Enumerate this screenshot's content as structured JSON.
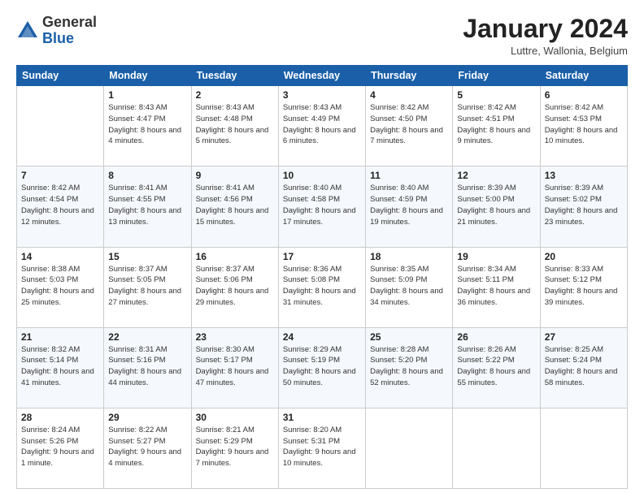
{
  "header": {
    "logo": {
      "general": "General",
      "blue": "Blue"
    },
    "title": "January 2024",
    "subtitle": "Luttre, Wallonia, Belgium"
  },
  "calendar": {
    "days_of_week": [
      "Sunday",
      "Monday",
      "Tuesday",
      "Wednesday",
      "Thursday",
      "Friday",
      "Saturday"
    ],
    "weeks": [
      [
        {
          "day": "",
          "sunrise": "",
          "sunset": "",
          "daylight": ""
        },
        {
          "day": "1",
          "sunrise": "Sunrise: 8:43 AM",
          "sunset": "Sunset: 4:47 PM",
          "daylight": "Daylight: 8 hours and 4 minutes."
        },
        {
          "day": "2",
          "sunrise": "Sunrise: 8:43 AM",
          "sunset": "Sunset: 4:48 PM",
          "daylight": "Daylight: 8 hours and 5 minutes."
        },
        {
          "day": "3",
          "sunrise": "Sunrise: 8:43 AM",
          "sunset": "Sunset: 4:49 PM",
          "daylight": "Daylight: 8 hours and 6 minutes."
        },
        {
          "day": "4",
          "sunrise": "Sunrise: 8:42 AM",
          "sunset": "Sunset: 4:50 PM",
          "daylight": "Daylight: 8 hours and 7 minutes."
        },
        {
          "day": "5",
          "sunrise": "Sunrise: 8:42 AM",
          "sunset": "Sunset: 4:51 PM",
          "daylight": "Daylight: 8 hours and 9 minutes."
        },
        {
          "day": "6",
          "sunrise": "Sunrise: 8:42 AM",
          "sunset": "Sunset: 4:53 PM",
          "daylight": "Daylight: 8 hours and 10 minutes."
        }
      ],
      [
        {
          "day": "7",
          "sunrise": "Sunrise: 8:42 AM",
          "sunset": "Sunset: 4:54 PM",
          "daylight": "Daylight: 8 hours and 12 minutes."
        },
        {
          "day": "8",
          "sunrise": "Sunrise: 8:41 AM",
          "sunset": "Sunset: 4:55 PM",
          "daylight": "Daylight: 8 hours and 13 minutes."
        },
        {
          "day": "9",
          "sunrise": "Sunrise: 8:41 AM",
          "sunset": "Sunset: 4:56 PM",
          "daylight": "Daylight: 8 hours and 15 minutes."
        },
        {
          "day": "10",
          "sunrise": "Sunrise: 8:40 AM",
          "sunset": "Sunset: 4:58 PM",
          "daylight": "Daylight: 8 hours and 17 minutes."
        },
        {
          "day": "11",
          "sunrise": "Sunrise: 8:40 AM",
          "sunset": "Sunset: 4:59 PM",
          "daylight": "Daylight: 8 hours and 19 minutes."
        },
        {
          "day": "12",
          "sunrise": "Sunrise: 8:39 AM",
          "sunset": "Sunset: 5:00 PM",
          "daylight": "Daylight: 8 hours and 21 minutes."
        },
        {
          "day": "13",
          "sunrise": "Sunrise: 8:39 AM",
          "sunset": "Sunset: 5:02 PM",
          "daylight": "Daylight: 8 hours and 23 minutes."
        }
      ],
      [
        {
          "day": "14",
          "sunrise": "Sunrise: 8:38 AM",
          "sunset": "Sunset: 5:03 PM",
          "daylight": "Daylight: 8 hours and 25 minutes."
        },
        {
          "day": "15",
          "sunrise": "Sunrise: 8:37 AM",
          "sunset": "Sunset: 5:05 PM",
          "daylight": "Daylight: 8 hours and 27 minutes."
        },
        {
          "day": "16",
          "sunrise": "Sunrise: 8:37 AM",
          "sunset": "Sunset: 5:06 PM",
          "daylight": "Daylight: 8 hours and 29 minutes."
        },
        {
          "day": "17",
          "sunrise": "Sunrise: 8:36 AM",
          "sunset": "Sunset: 5:08 PM",
          "daylight": "Daylight: 8 hours and 31 minutes."
        },
        {
          "day": "18",
          "sunrise": "Sunrise: 8:35 AM",
          "sunset": "Sunset: 5:09 PM",
          "daylight": "Daylight: 8 hours and 34 minutes."
        },
        {
          "day": "19",
          "sunrise": "Sunrise: 8:34 AM",
          "sunset": "Sunset: 5:11 PM",
          "daylight": "Daylight: 8 hours and 36 minutes."
        },
        {
          "day": "20",
          "sunrise": "Sunrise: 8:33 AM",
          "sunset": "Sunset: 5:12 PM",
          "daylight": "Daylight: 8 hours and 39 minutes."
        }
      ],
      [
        {
          "day": "21",
          "sunrise": "Sunrise: 8:32 AM",
          "sunset": "Sunset: 5:14 PM",
          "daylight": "Daylight: 8 hours and 41 minutes."
        },
        {
          "day": "22",
          "sunrise": "Sunrise: 8:31 AM",
          "sunset": "Sunset: 5:16 PM",
          "daylight": "Daylight: 8 hours and 44 minutes."
        },
        {
          "day": "23",
          "sunrise": "Sunrise: 8:30 AM",
          "sunset": "Sunset: 5:17 PM",
          "daylight": "Daylight: 8 hours and 47 minutes."
        },
        {
          "day": "24",
          "sunrise": "Sunrise: 8:29 AM",
          "sunset": "Sunset: 5:19 PM",
          "daylight": "Daylight: 8 hours and 50 minutes."
        },
        {
          "day": "25",
          "sunrise": "Sunrise: 8:28 AM",
          "sunset": "Sunset: 5:20 PM",
          "daylight": "Daylight: 8 hours and 52 minutes."
        },
        {
          "day": "26",
          "sunrise": "Sunrise: 8:26 AM",
          "sunset": "Sunset: 5:22 PM",
          "daylight": "Daylight: 8 hours and 55 minutes."
        },
        {
          "day": "27",
          "sunrise": "Sunrise: 8:25 AM",
          "sunset": "Sunset: 5:24 PM",
          "daylight": "Daylight: 8 hours and 58 minutes."
        }
      ],
      [
        {
          "day": "28",
          "sunrise": "Sunrise: 8:24 AM",
          "sunset": "Sunset: 5:26 PM",
          "daylight": "Daylight: 9 hours and 1 minute."
        },
        {
          "day": "29",
          "sunrise": "Sunrise: 8:22 AM",
          "sunset": "Sunset: 5:27 PM",
          "daylight": "Daylight: 9 hours and 4 minutes."
        },
        {
          "day": "30",
          "sunrise": "Sunrise: 8:21 AM",
          "sunset": "Sunset: 5:29 PM",
          "daylight": "Daylight: 9 hours and 7 minutes."
        },
        {
          "day": "31",
          "sunrise": "Sunrise: 8:20 AM",
          "sunset": "Sunset: 5:31 PM",
          "daylight": "Daylight: 9 hours and 10 minutes."
        },
        {
          "day": "",
          "sunrise": "",
          "sunset": "",
          "daylight": ""
        },
        {
          "day": "",
          "sunrise": "",
          "sunset": "",
          "daylight": ""
        },
        {
          "day": "",
          "sunrise": "",
          "sunset": "",
          "daylight": ""
        }
      ]
    ]
  }
}
